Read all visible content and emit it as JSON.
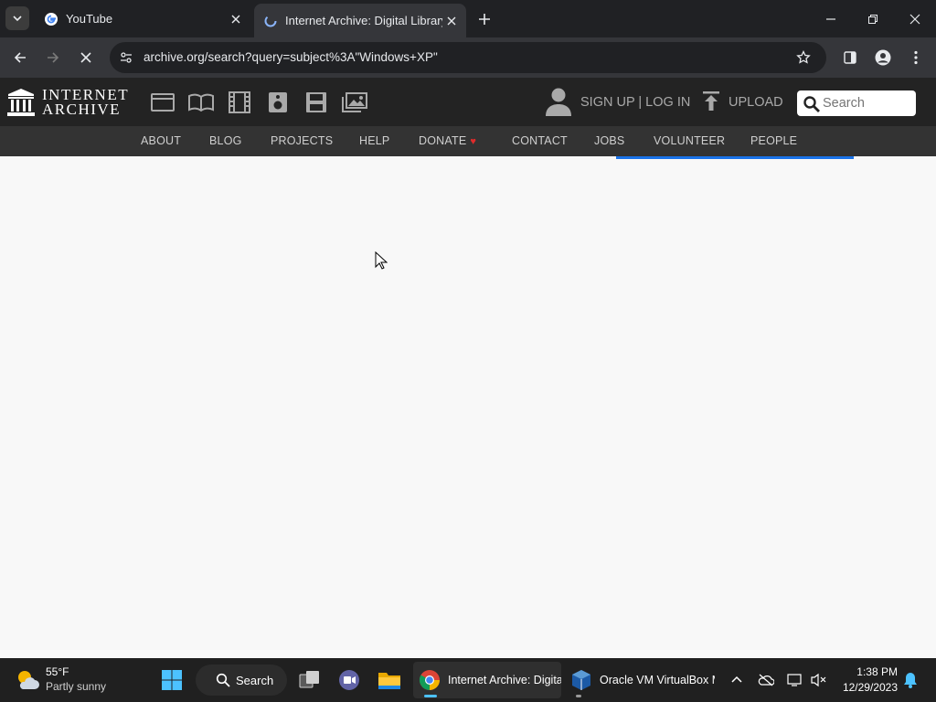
{
  "browser": {
    "tabs": [
      {
        "title": "YouTube",
        "active": false
      },
      {
        "title": "Internet Archive: Digital Library",
        "active": true
      }
    ],
    "url": "archive.org/search?query=subject%3A\"Windows+XP\""
  },
  "ia": {
    "logo_line1": "INTERNET",
    "logo_line2": "ARCHIVE",
    "media_icons": [
      "web-icon",
      "texts-icon",
      "video-icon",
      "audio-icon",
      "software-icon",
      "images-icon"
    ],
    "signin": "SIGN UP | LOG IN",
    "upload": "UPLOAD",
    "search_placeholder": "Search",
    "nav": [
      "ABOUT",
      "BLOG",
      "PROJECTS",
      "HELP",
      "DONATE",
      "CONTACT",
      "JOBS",
      "VOLUNTEER",
      "PEOPLE"
    ],
    "colors": {
      "header": "#232323",
      "nav": "#333333",
      "progress": "#1a73e8"
    }
  },
  "taskbar": {
    "weather_temp": "55°F",
    "weather_desc": "Partly sunny",
    "search_label": "Search",
    "apps": [
      {
        "title": "Internet Archive: Digital Library - Google Chrome",
        "active": true
      },
      {
        "title": "Oracle VM VirtualBox Manager",
        "active": false
      }
    ],
    "time": "1:38 PM",
    "date": "12/29/2023"
  }
}
